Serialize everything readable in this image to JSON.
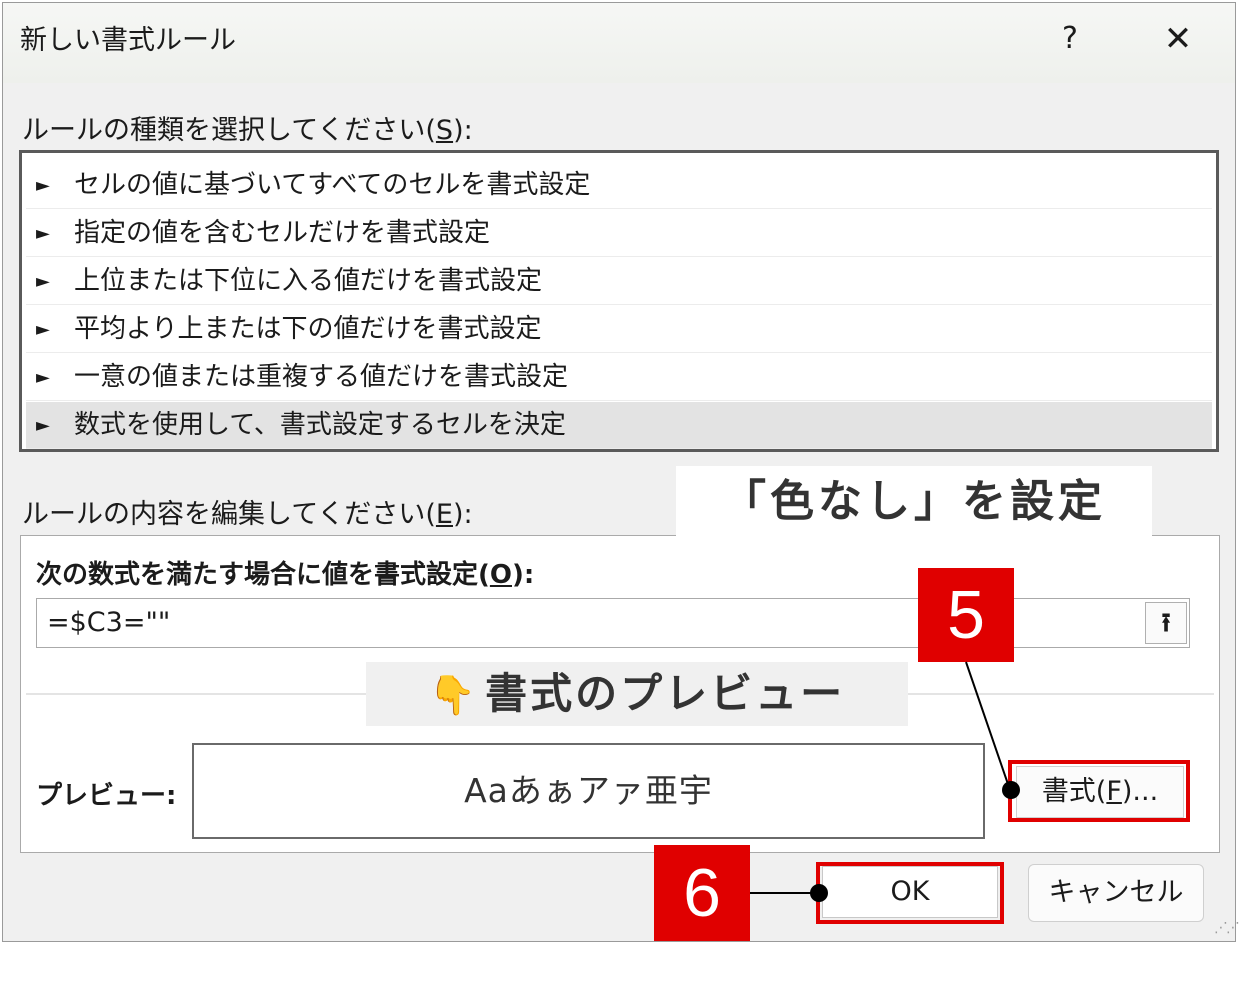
{
  "dialog": {
    "title": "新しい書式ルール",
    "help": "?",
    "close": "✕"
  },
  "rule_type": {
    "label": "ルールの種類を選択してください(",
    "accel": "S",
    "label_end": "):",
    "items": [
      {
        "text": "セルの値に基づいてすべてのセルを書式設定",
        "selected": false
      },
      {
        "text": "指定の値を含むセルだけを書式設定",
        "selected": false
      },
      {
        "text": "上位または下位に入る値だけを書式設定",
        "selected": false
      },
      {
        "text": "平均より上または下の値だけを書式設定",
        "selected": false
      },
      {
        "text": "一意の値または重複する値だけを書式設定",
        "selected": false
      },
      {
        "text": "数式を使用して、書式設定するセルを決定",
        "selected": true
      }
    ],
    "arrow": "►"
  },
  "rule_edit": {
    "label": "ルールの内容を編集してください(",
    "accel": "E",
    "label_end": "):",
    "formula_label": "次の数式を満たす場合に値を書式設定(",
    "formula_accel": "O",
    "formula_label_end": "):",
    "formula_value": "=$C3=\"\"",
    "collapse_icon": "⭱",
    "preview_label": "プレビュー:",
    "preview_text": "Aaあぁアァ亜宇",
    "format_button": "書式(",
    "format_accel": "F",
    "format_button_end": ")..."
  },
  "footer": {
    "ok": "OK",
    "cancel": "キャンセル"
  },
  "annotations": {
    "banner": "「色なし」を設定",
    "preview_heading": "書式のプレビュー",
    "hand_icon": "👇",
    "badge_5": "5",
    "badge_6": "6"
  },
  "colors": {
    "highlight_red": "#e00000",
    "dialog_bg": "#f0f0f0",
    "selected_row": "#e3e3e3"
  }
}
